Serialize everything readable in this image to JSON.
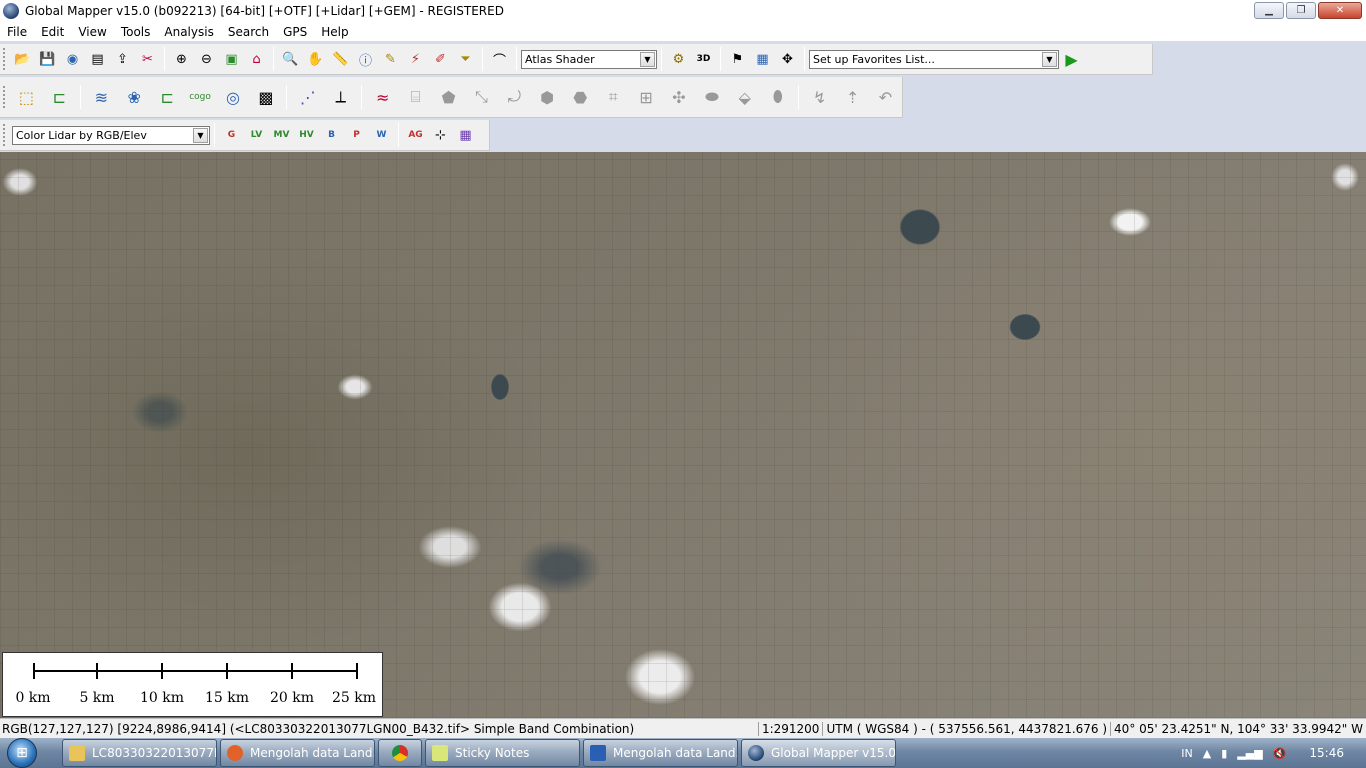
{
  "title_bar": {
    "title": "Global Mapper v15.0 (b092213) [64-bit] [+OTF] [+Lidar] [+GEM] - REGISTERED"
  },
  "menu": [
    "File",
    "Edit",
    "View",
    "Tools",
    "Analysis",
    "Search",
    "GPS",
    "Help"
  ],
  "toolbar": {
    "shader_value": "Atlas Shader",
    "favorites_value": "Set up Favorites List...",
    "lidar_color_value": "Color Lidar by RGB/Elev",
    "lidar_class_buttons": [
      "G",
      "LV",
      "MV",
      "HV",
      "B",
      "P",
      "W",
      "AG"
    ]
  },
  "scalebar": {
    "labels": [
      "0 km",
      "5 km",
      "10 km",
      "15 km",
      "20 km",
      "25 km"
    ]
  },
  "status_bar": {
    "info": "RGB(127,127,127) [9224,8986,9414] (<LC80330322013077LGN00_B432.tif> Simple Band Combination)",
    "scale": "1:291200",
    "projection": "UTM ( WGS84 ) - ( 537556.561, 4437821.676 )",
    "latlon": "40° 05' 23.4251\" N, 104° 33' 33.9942\" W"
  },
  "taskbar": {
    "items": [
      {
        "label": "LC80330322013077L...",
        "icon": "folder-icon",
        "color": "#e8c45a"
      },
      {
        "label": "Mengolah data Land...",
        "icon": "firefox-icon",
        "color": "#e0622a"
      },
      {
        "label": "",
        "icon": "chrome-icon",
        "color": "#4caf50"
      },
      {
        "label": "Sticky Notes",
        "icon": "sticky-notes-icon",
        "color": "#d9e77a"
      },
      {
        "label": "Mengolah data Land...",
        "icon": "word-icon",
        "color": "#2b5fb4"
      },
      {
        "label": "Global Mapper v15.0 ...",
        "icon": "global-mapper-icon",
        "color": "#2e4d78"
      }
    ],
    "language": "IN",
    "clock": "15:46"
  }
}
